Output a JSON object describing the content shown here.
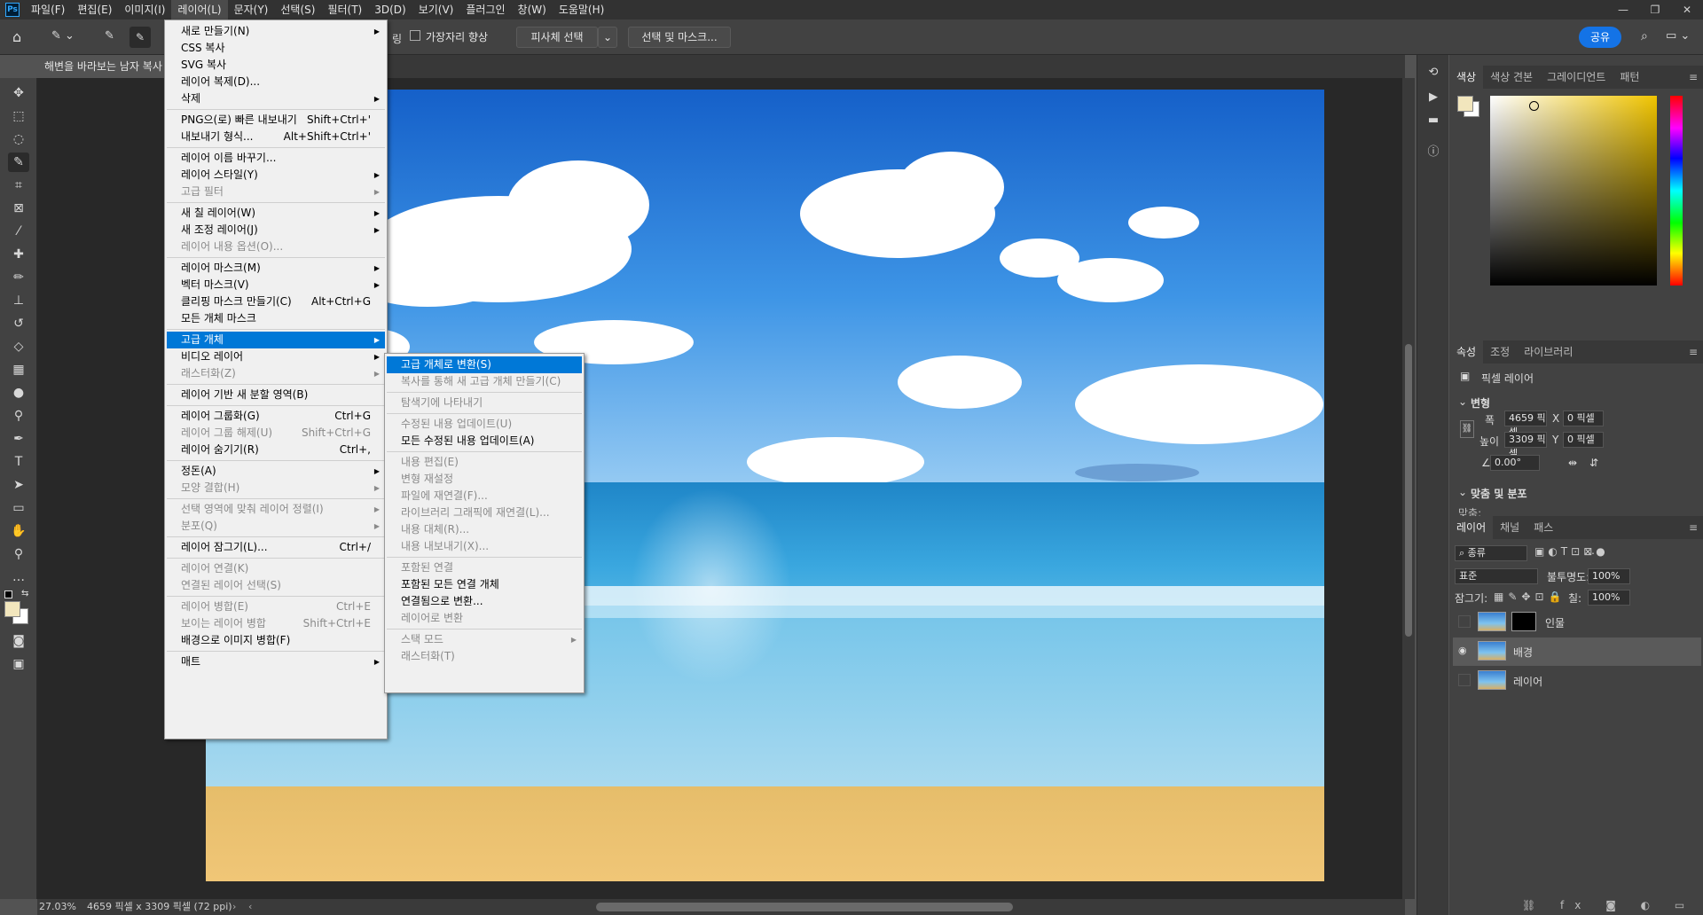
{
  "menubar": {
    "logo": "Ps",
    "items": [
      "파일(F)",
      "편집(E)",
      "이미지(I)",
      "레이어(L)",
      "문자(Y)",
      "선택(S)",
      "필터(T)",
      "3D(D)",
      "보기(V)",
      "플러그인",
      "창(W)",
      "도움말(H)"
    ],
    "active_index": 3
  },
  "optionsbar": {
    "edge_enhance_label": "가장자리 향상",
    "subject_select_label": "피사체 선택",
    "select_mask_label": "선택 및 마스크...",
    "share_label": "공유"
  },
  "document": {
    "tab_title": "해변을 바라보는 남자 복사",
    "zoom": "27.03%",
    "dimensions": "4659 픽셀 x 3309 픽셀 (72 ppi)"
  },
  "layer_menu": {
    "items": [
      {
        "label": "새로 만들기(N)",
        "shortcut": "",
        "submenu": true,
        "disabled": false
      },
      {
        "label": "CSS 복사",
        "shortcut": "",
        "submenu": false,
        "disabled": false
      },
      {
        "label": "SVG 복사",
        "shortcut": "",
        "submenu": false,
        "disabled": false
      },
      {
        "label": "레이어 복제(D)...",
        "shortcut": "",
        "submenu": false,
        "disabled": false
      },
      {
        "label": "삭제",
        "shortcut": "",
        "submenu": true,
        "disabled": false
      },
      {
        "sep": true
      },
      {
        "label": "PNG으(로) 빠른 내보내기",
        "shortcut": "Shift+Ctrl+'",
        "submenu": false,
        "disabled": false
      },
      {
        "label": "내보내기 형식...",
        "shortcut": "Alt+Shift+Ctrl+'",
        "submenu": false,
        "disabled": false
      },
      {
        "sep": true
      },
      {
        "label": "레이어 이름 바꾸기...",
        "shortcut": "",
        "submenu": false,
        "disabled": false
      },
      {
        "label": "레이어 스타일(Y)",
        "shortcut": "",
        "submenu": true,
        "disabled": false
      },
      {
        "label": "고급 필터",
        "shortcut": "",
        "submenu": true,
        "disabled": true
      },
      {
        "sep": true
      },
      {
        "label": "새 칠 레이어(W)",
        "shortcut": "",
        "submenu": true,
        "disabled": false
      },
      {
        "label": "새 조정 레이어(J)",
        "shortcut": "",
        "submenu": true,
        "disabled": false
      },
      {
        "label": "레이어 내용 옵션(O)...",
        "shortcut": "",
        "submenu": false,
        "disabled": true
      },
      {
        "sep": true
      },
      {
        "label": "레이어 마스크(M)",
        "shortcut": "",
        "submenu": true,
        "disabled": false
      },
      {
        "label": "벡터 마스크(V)",
        "shortcut": "",
        "submenu": true,
        "disabled": false
      },
      {
        "label": "클리핑 마스크 만들기(C)",
        "shortcut": "Alt+Ctrl+G",
        "submenu": false,
        "disabled": false
      },
      {
        "label": "모든 개체 마스크",
        "shortcut": "",
        "submenu": false,
        "disabled": false
      },
      {
        "sep": true
      },
      {
        "label": "고급 개체",
        "shortcut": "",
        "submenu": true,
        "disabled": false,
        "highlight": true
      },
      {
        "label": "비디오 레이어",
        "shortcut": "",
        "submenu": true,
        "disabled": false
      },
      {
        "label": "래스터화(Z)",
        "shortcut": "",
        "submenu": true,
        "disabled": true
      },
      {
        "sep": true
      },
      {
        "label": "레이어 기반 새 분할 영역(B)",
        "shortcut": "",
        "submenu": false,
        "disabled": false
      },
      {
        "sep": true
      },
      {
        "label": "레이어 그룹화(G)",
        "shortcut": "Ctrl+G",
        "submenu": false,
        "disabled": false
      },
      {
        "label": "레이어 그룹 해제(U)",
        "shortcut": "Shift+Ctrl+G",
        "submenu": false,
        "disabled": true
      },
      {
        "label": "레이어 숨기기(R)",
        "shortcut": "Ctrl+,",
        "submenu": false,
        "disabled": false
      },
      {
        "sep": true
      },
      {
        "label": "정돈(A)",
        "shortcut": "",
        "submenu": true,
        "disabled": false
      },
      {
        "label": "모양 결합(H)",
        "shortcut": "",
        "submenu": true,
        "disabled": true
      },
      {
        "sep": true
      },
      {
        "label": "선택 영역에 맞춰 레이어 정렬(I)",
        "shortcut": "",
        "submenu": true,
        "disabled": true
      },
      {
        "label": "분포(Q)",
        "shortcut": "",
        "submenu": true,
        "disabled": true
      },
      {
        "sep": true
      },
      {
        "label": "레이어 잠그기(L)...",
        "shortcut": "Ctrl+/",
        "submenu": false,
        "disabled": false
      },
      {
        "sep": true
      },
      {
        "label": "레이어 연결(K)",
        "shortcut": "",
        "submenu": false,
        "disabled": true
      },
      {
        "label": "연결된 레이어 선택(S)",
        "shortcut": "",
        "submenu": false,
        "disabled": true
      },
      {
        "sep": true
      },
      {
        "label": "레이어 병합(E)",
        "shortcut": "Ctrl+E",
        "submenu": false,
        "disabled": true
      },
      {
        "label": "보이는 레이어 병합",
        "shortcut": "Shift+Ctrl+E",
        "submenu": false,
        "disabled": true
      },
      {
        "label": "배경으로 이미지 병합(F)",
        "shortcut": "",
        "submenu": false,
        "disabled": false
      },
      {
        "sep": true
      },
      {
        "label": "매트",
        "shortcut": "",
        "submenu": true,
        "disabled": false
      }
    ]
  },
  "smart_object_menu": {
    "items": [
      {
        "label": "고급 개체로 변환(S)",
        "submenu": false,
        "disabled": false,
        "highlight": true
      },
      {
        "label": "복사를 통해 새 고급 개체 만들기(C)",
        "submenu": false,
        "disabled": true
      },
      {
        "sep": true
      },
      {
        "label": "탐색기에 나타내기",
        "submenu": false,
        "disabled": true
      },
      {
        "sep": true
      },
      {
        "label": "수정된 내용 업데이트(U)",
        "submenu": false,
        "disabled": true
      },
      {
        "label": "모든 수정된 내용 업데이트(A)",
        "submenu": false,
        "disabled": false
      },
      {
        "sep": true
      },
      {
        "label": "내용 편집(E)",
        "submenu": false,
        "disabled": true
      },
      {
        "label": "변형 재설정",
        "submenu": false,
        "disabled": true
      },
      {
        "label": "파일에 재연결(F)...",
        "submenu": false,
        "disabled": true
      },
      {
        "label": "라이브러리 그래픽에 재연결(L)...",
        "submenu": false,
        "disabled": true
      },
      {
        "label": "내용 대체(R)...",
        "submenu": false,
        "disabled": true
      },
      {
        "label": "내용 내보내기(X)...",
        "submenu": false,
        "disabled": true
      },
      {
        "sep": true
      },
      {
        "label": "포함된 연결",
        "submenu": false,
        "disabled": true
      },
      {
        "label": "포함된 모든 연결 개체",
        "submenu": false,
        "disabled": false
      },
      {
        "label": "연결됨으로 변환...",
        "submenu": false,
        "disabled": false
      },
      {
        "label": "레이어로 변환",
        "submenu": false,
        "disabled": true
      },
      {
        "sep": true
      },
      {
        "label": "스택 모드",
        "submenu": true,
        "disabled": true
      },
      {
        "label": "래스터화(T)",
        "submenu": false,
        "disabled": true
      }
    ]
  },
  "color_panel": {
    "tabs": [
      "색상",
      "색상 견본",
      "그레이디언트",
      "패턴"
    ],
    "foreground": "#f2e6bd",
    "background": "#ffffff",
    "hue_color": "#f0c400"
  },
  "properties_panel": {
    "tabs": [
      "속성",
      "조정",
      "라이브러리"
    ],
    "type_label": "픽셀 레이어",
    "transform_header": "변형",
    "w_label": "폭",
    "w_value": "4659 픽셀",
    "h_label": "높이",
    "h_value": "3309 픽셀",
    "x_label": "X",
    "x_value": "0 픽셀",
    "y_label": "Y",
    "y_value": "0 픽셀",
    "angle_value": "0.00°",
    "align_header": "맞춤 및 분포",
    "align_label": "맞춤:"
  },
  "layers_panel": {
    "tabs": [
      "레이어",
      "채널",
      "패스"
    ],
    "filter_kind": "종류",
    "blend_mode": "표준",
    "opacity_label": "불투명도:",
    "opacity_value": "100%",
    "lock_label": "잠그기:",
    "fill_label": "칠:",
    "fill_value": "100%",
    "layers": [
      {
        "name": "인물",
        "visible": false,
        "selected": false,
        "has_mask": true
      },
      {
        "name": "배경",
        "visible": true,
        "selected": true,
        "has_mask": false
      },
      {
        "name": "레이어",
        "visible": false,
        "selected": false,
        "has_mask": false
      }
    ]
  }
}
